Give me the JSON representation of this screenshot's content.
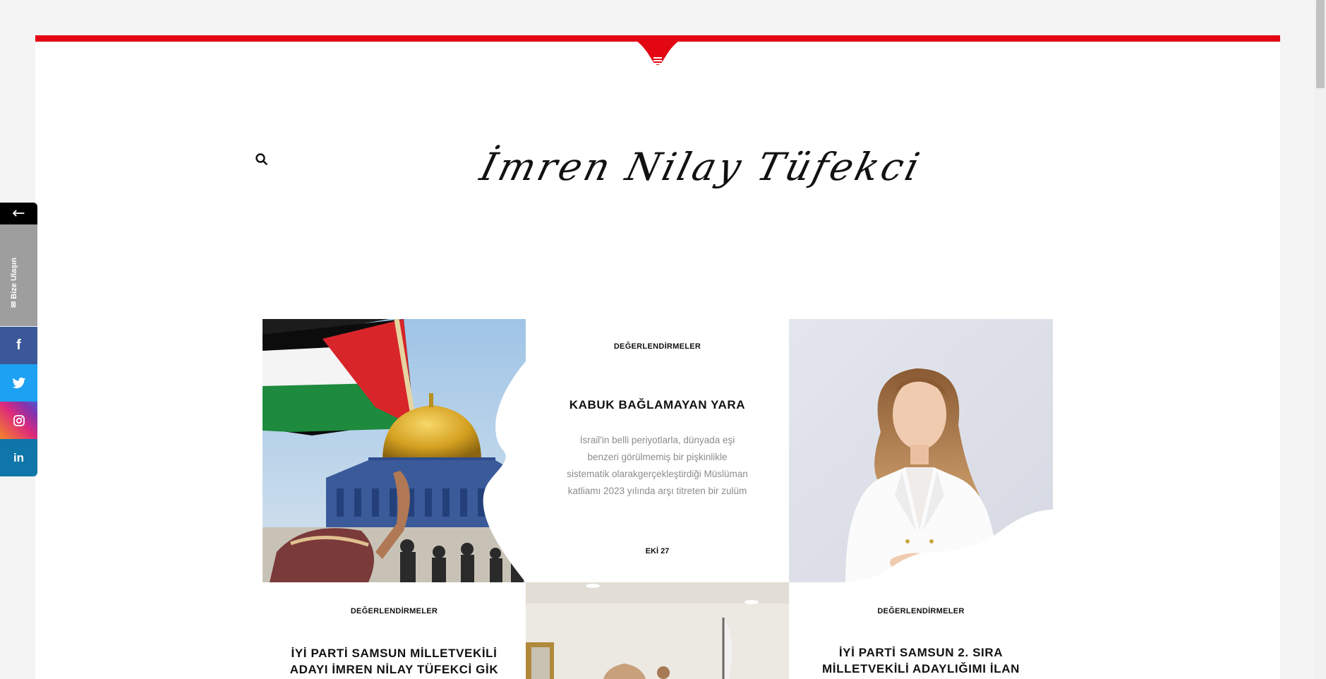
{
  "header": {
    "logo_text": "İmren Nilay Tüfekci",
    "accent_color": "#e30613",
    "menu_icon": "hamburger-icon",
    "search_icon": "search-icon"
  },
  "side_bar": {
    "arrow": "←",
    "contact_label": "✉ Bize Ulaşın",
    "social": [
      {
        "name": "facebook",
        "glyph": "f",
        "color": "#3b5998"
      },
      {
        "name": "twitter",
        "glyph": "t",
        "color": "#1da1f2"
      },
      {
        "name": "instagram",
        "glyph": "◎",
        "color": "#dd2a7b"
      },
      {
        "name": "linkedin",
        "glyph": "in",
        "color": "#0e76a8"
      }
    ]
  },
  "posts": [
    {
      "category": "DEĞERLENDİRMELER",
      "title": "KABUK BAĞLAMAYAN YARA",
      "excerpt_lines": [
        "İsrail'in belli periyotlarla, dünyada eşi",
        "benzeri görülmemiş bir pişkinlikle",
        "sistematik olarakgerçekleştirdiği Müslüman",
        "katliamı 2023 yılında arşı titreten bir zulüm"
      ],
      "date": "EKİ 27"
    },
    {
      "category": "DEĞERLENDİRMELER",
      "title_lines": [
        "İYİ PARTİ SAMSUN MİLLETVEKİLİ",
        "ADAYI İMREN NİLAY TÜFEKCİ GİK"
      ]
    },
    {
      "category": "DEĞERLENDİRMELER",
      "title_lines": [
        "İYİ PARTİ SAMSUN 2. SIRA",
        "MİLLETVEKİLİ ADAYLIĞIMI İLAN"
      ]
    }
  ]
}
